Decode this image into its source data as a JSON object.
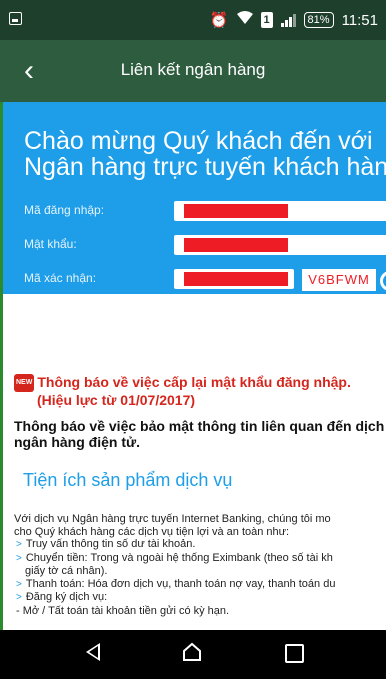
{
  "statusbar": {
    "battery": "81%",
    "time": "11:51",
    "sim_label": "1"
  },
  "header": {
    "title": "Liên kết ngân hàng",
    "back_icon": "chevron-left-icon"
  },
  "login": {
    "welcome_line1": "Chào mừng Quý khách đến với",
    "welcome_line2": "Ngân hàng trực tuyến khách hàng",
    "username_label": "Mã đăng nhập:",
    "password_label": "Mật khẩu:",
    "captcha_label": "Mã xác nhận:",
    "captcha_value": "V6BFWM"
  },
  "content": {
    "new_badge": "NEW",
    "notice_line1": "Thông báo về việc cấp lại mật khẩu đăng nhập.",
    "notice_line2": "(Hiệu lực từ 01/07/2017)",
    "notice2_line1": "Thông báo về việc bảo mật thông tin liên quan đến dịch",
    "notice2_line2": "ngân hàng điện tử.",
    "section_title": "Tiện ích sản phẩm dịch vụ",
    "intro_line1": "Với dịch vụ Ngân hàng trực tuyến Internet Banking, chúng tôi mo",
    "intro_line2": "cho Quý khách hàng các dịch vụ tiện lợi và an toàn như:",
    "items": [
      "Truy vấn thông tin số dư tài khoản.",
      "Chuyển tiền: Trong và ngoài hệ thống Eximbank (theo số tài kh",
      "giấy tờ cá nhân).",
      "Thanh toán: Hóa đơn dịch vụ, thanh toán nợ vay, thanh toán du",
      "Đăng ký dịch vụ:",
      "- Mở / Tất toán tài khoản tiền gửi có kỳ hạn."
    ]
  },
  "colors": {
    "header_bg": "#2e5c3f",
    "login_bg": "#1e9ee8",
    "redaction": "#ee1c24",
    "notice_red": "#d5261d",
    "section_blue": "#1e9ee8"
  }
}
